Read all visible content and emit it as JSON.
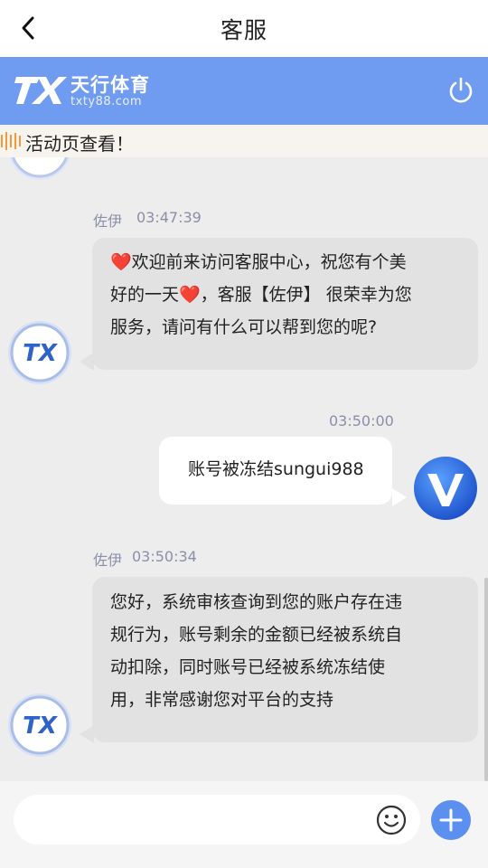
{
  "header": {
    "title": "客服"
  },
  "brand": {
    "name": "天行体育",
    "url": "txty88.com"
  },
  "marquee": {
    "text": "活动页查看！"
  },
  "messages": [
    {
      "side": "left",
      "name": "佐伊",
      "time": "03:47:39",
      "lines": [
        "❤️欢迎前来访问客服中心，祝您有个美",
        "好的一天❤️，客服【佐伊】 很荣幸为您",
        "服务，请问有什么可以帮到您的呢?"
      ]
    },
    {
      "side": "right",
      "time": "03:50:00",
      "lines": [
        "账号被冻结sungui988"
      ]
    },
    {
      "side": "left",
      "name": "佐伊",
      "time": "03:50:34",
      "lines": [
        "您好，系统审核查询到您的账户存在违",
        "规行为，账号剩余的金额已经被系统自",
        "动扣除，同时账号已经被系统冻结使",
        "用，非常感谢您对平台的支持"
      ]
    }
  ],
  "input": {
    "placeholder": ""
  },
  "colors": {
    "brand_bar": "#6f9bf0",
    "plus_button": "#5b8ff0",
    "chat_bg": "#ededed"
  },
  "icons": {
    "back": "chevron-left-icon",
    "power": "power-icon",
    "emoji": "smiley-icon",
    "add": "plus-icon"
  }
}
